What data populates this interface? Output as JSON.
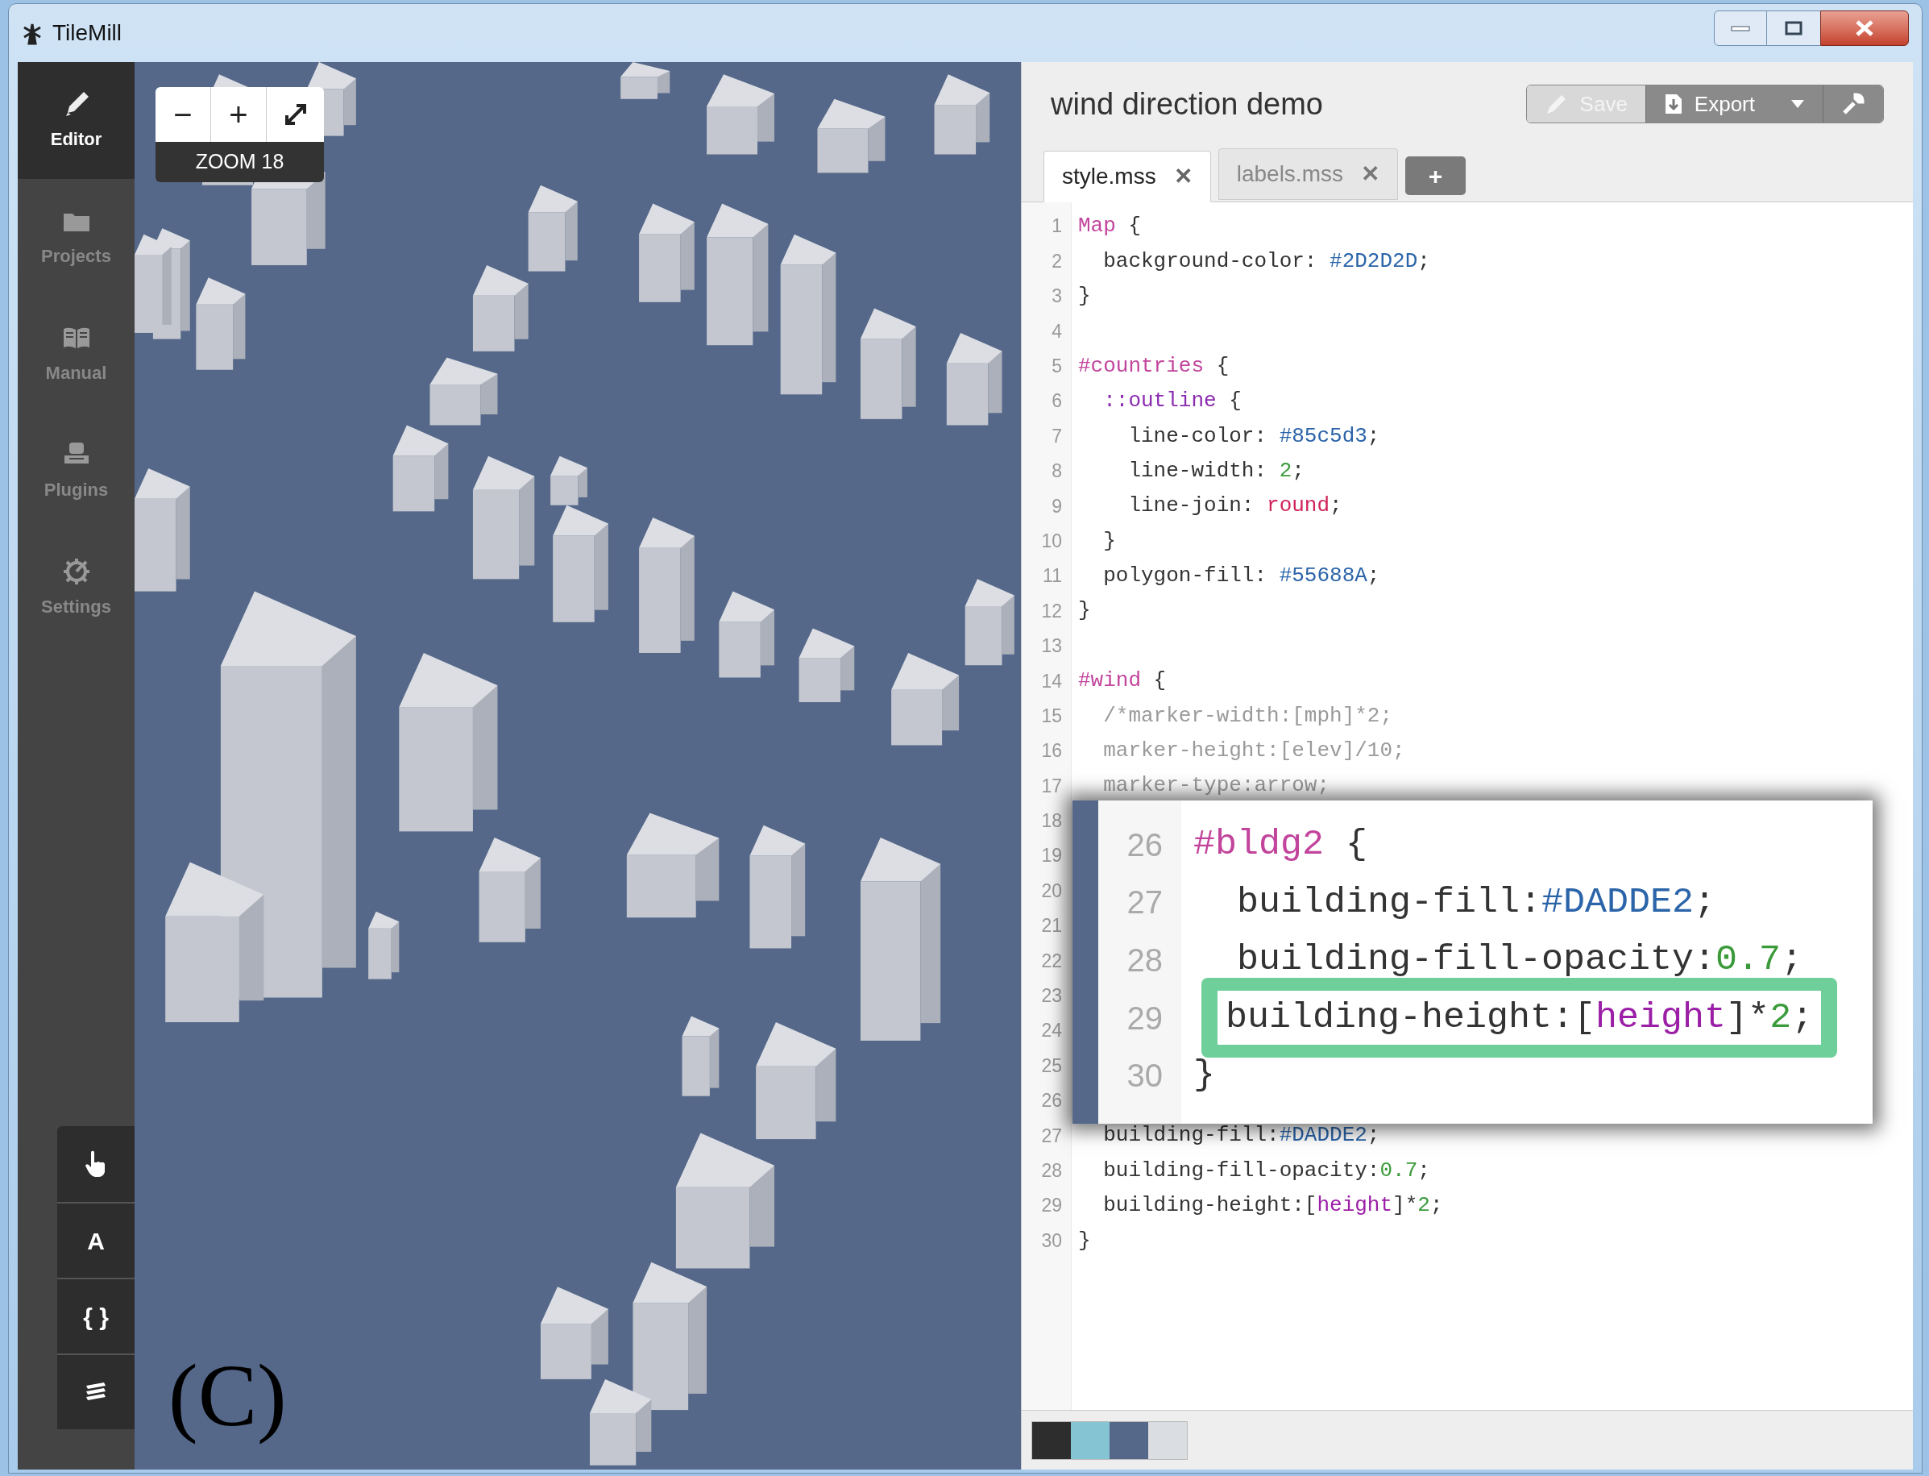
{
  "window": {
    "title": "TileMill"
  },
  "sidebar": {
    "items": [
      {
        "kind": "editor",
        "label": "Editor",
        "selected": true
      },
      {
        "kind": "projects",
        "label": "Projects",
        "selected": false
      },
      {
        "kind": "manual",
        "label": "Manual",
        "selected": false
      },
      {
        "kind": "plugins",
        "label": "Plugins",
        "selected": false
      },
      {
        "kind": "settings",
        "label": "Settings",
        "selected": false
      }
    ],
    "tools": [
      {
        "kind": "pointer"
      },
      {
        "kind": "text",
        "label": "A"
      },
      {
        "kind": "text",
        "label": "{ }"
      },
      {
        "kind": "layers"
      }
    ]
  },
  "map": {
    "zoom_out": "−",
    "zoom_in": "+",
    "zoom_label": "ZOOM 18",
    "figure_label": "(C)"
  },
  "editor": {
    "project_title": "wind direction demo",
    "actions": [
      {
        "kind": "save",
        "label": "Save",
        "disabled": true
      },
      {
        "kind": "export",
        "label": "Export",
        "disabled": false
      },
      {
        "kind": "tools",
        "disabled": false
      }
    ],
    "tabs": [
      {
        "label": "style.mss",
        "close": "✕",
        "selected": true
      },
      {
        "label": "labels.mss",
        "close": "✕",
        "selected": false
      }
    ],
    "add_tab": "+",
    "lines": [
      {
        "number": "1",
        "tokens": [
          {
            "kind": "selector",
            "text": "Map"
          },
          {
            "kind": "plain",
            "text": " {"
          }
        ]
      },
      {
        "number": "2",
        "tokens": [
          {
            "kind": "plain",
            "text": "  background-color: "
          },
          {
            "kind": "color",
            "text": "#2D2D2D"
          },
          {
            "kind": "plain",
            "text": ";"
          }
        ]
      },
      {
        "number": "3",
        "tokens": [
          {
            "kind": "plain",
            "text": "}"
          }
        ]
      },
      {
        "number": "4"
      },
      {
        "number": "5",
        "tokens": [
          {
            "kind": "selector",
            "text": "#countries"
          },
          {
            "kind": "plain",
            "text": " {"
          }
        ]
      },
      {
        "number": "6",
        "tokens": [
          {
            "kind": "keyword",
            "text": "  ::outline"
          },
          {
            "kind": "plain",
            "text": " {"
          }
        ]
      },
      {
        "number": "7",
        "tokens": [
          {
            "kind": "plain",
            "text": "    line-color: "
          },
          {
            "kind": "color",
            "text": "#85c5d3"
          },
          {
            "kind": "plain",
            "text": ";"
          }
        ]
      },
      {
        "number": "8",
        "tokens": [
          {
            "kind": "plain",
            "text": "    line-width: "
          },
          {
            "kind": "number",
            "text": "2"
          },
          {
            "kind": "plain",
            "text": ";"
          }
        ]
      },
      {
        "number": "9",
        "tokens": [
          {
            "kind": "plain",
            "text": "    line-join: "
          },
          {
            "kind": "string",
            "text": "round"
          },
          {
            "kind": "plain",
            "text": ";"
          }
        ]
      },
      {
        "number": "10",
        "tokens": [
          {
            "kind": "plain",
            "text": "  }"
          }
        ]
      },
      {
        "number": "11",
        "tokens": [
          {
            "kind": "plain",
            "text": "  polygon-fill: "
          },
          {
            "kind": "color",
            "text": "#55688A"
          },
          {
            "kind": "plain",
            "text": ";"
          }
        ]
      },
      {
        "number": "12",
        "tokens": [
          {
            "kind": "plain",
            "text": "}"
          }
        ]
      },
      {
        "number": "13"
      },
      {
        "number": "14",
        "tokens": [
          {
            "kind": "selector",
            "text": "#wind"
          },
          {
            "kind": "plain",
            "text": " {"
          }
        ]
      },
      {
        "number": "15",
        "tokens": [
          {
            "kind": "comment",
            "text": "  /*marker-width:[mph]*2;"
          }
        ]
      },
      {
        "number": "16",
        "tokens": [
          {
            "kind": "comment",
            "text": "  marker-height:[elev]/10;"
          }
        ]
      },
      {
        "number": "17",
        "tokens": [
          {
            "kind": "comment",
            "text": "  marker-type:arrow;"
          }
        ]
      },
      {
        "number": "18"
      },
      {
        "number": "19"
      },
      {
        "number": "20"
      },
      {
        "number": "21"
      },
      {
        "number": "22"
      },
      {
        "number": "23"
      },
      {
        "number": "24"
      },
      {
        "number": "25"
      },
      {
        "number": "26"
      },
      {
        "number": "27",
        "tokens": [
          {
            "kind": "plain",
            "text": "  building-fill:"
          },
          {
            "kind": "color",
            "text": "#DADDE2"
          },
          {
            "kind": "plain",
            "text": ";"
          }
        ]
      },
      {
        "number": "28",
        "tokens": [
          {
            "kind": "plain",
            "text": "  building-fill-opacity:"
          },
          {
            "kind": "number",
            "text": "0.7"
          },
          {
            "kind": "plain",
            "text": ";"
          }
        ]
      },
      {
        "number": "29",
        "tokens": [
          {
            "kind": "plain",
            "text": "  building-height:["
          },
          {
            "kind": "variable",
            "text": "height"
          },
          {
            "kind": "plain",
            "text": "]*"
          },
          {
            "kind": "number",
            "text": "2"
          },
          {
            "kind": "plain",
            "text": ";"
          }
        ]
      },
      {
        "number": "30",
        "tokens": [
          {
            "kind": "plain",
            "text": "}"
          }
        ]
      }
    ],
    "callout": {
      "lines": [
        {
          "number": "26",
          "highlighted": false,
          "tokens": [
            {
              "kind": "selector",
              "text": "#bldg2"
            },
            {
              "kind": "plain",
              "text": " {"
            }
          ]
        },
        {
          "number": "27",
          "highlighted": false,
          "tokens": [
            {
              "kind": "plain",
              "text": "  building-fill:"
            },
            {
              "kind": "color",
              "text": "#DADDE2"
            },
            {
              "kind": "plain",
              "text": ";"
            }
          ]
        },
        {
          "number": "28",
          "highlighted": false,
          "tokens": [
            {
              "kind": "plain",
              "text": "  building-fill-opacity:"
            },
            {
              "kind": "number",
              "text": "0.7"
            },
            {
              "kind": "plain",
              "text": ";"
            }
          ]
        },
        {
          "number": "29",
          "highlighted": true,
          "tokens": [
            {
              "kind": "plain",
              "text": "building-height:["
            },
            {
              "kind": "variable",
              "text": "height"
            },
            {
              "kind": "plain",
              "text": "]*"
            },
            {
              "kind": "number",
              "text": "2"
            },
            {
              "kind": "plain",
              "text": ";"
            }
          ]
        },
        {
          "number": "30",
          "highlighted": false,
          "tokens": [
            {
              "kind": "plain",
              "text": "}"
            }
          ]
        }
      ]
    },
    "swatches": [
      {
        "color": "#2d2d2d"
      },
      {
        "color": "#85c5d3"
      },
      {
        "color": "#55688a"
      },
      {
        "color": "#dadde2"
      }
    ]
  }
}
